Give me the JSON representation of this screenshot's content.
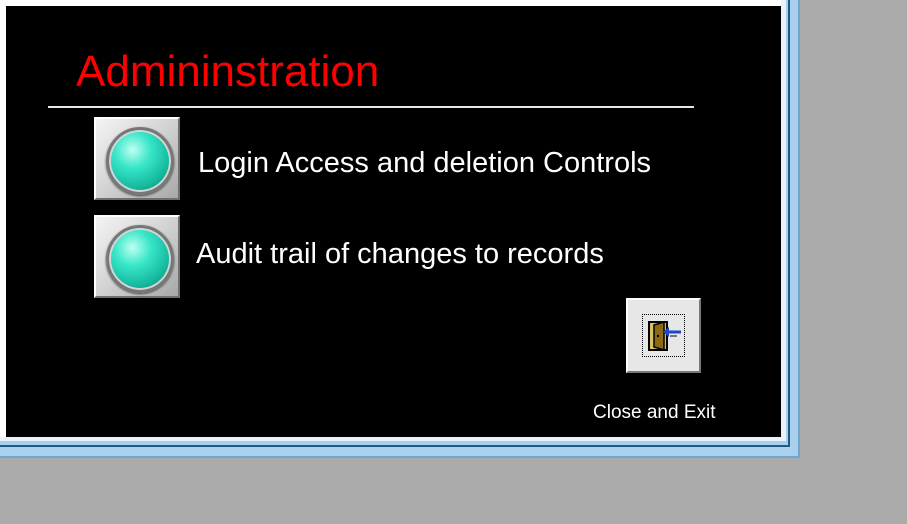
{
  "colors": {
    "panel_background": "#000000",
    "title_color": "#ff0000",
    "text_color": "#ffffff",
    "led_color": "#37e6c8",
    "desktop_background": "#ababab"
  },
  "title": "Admininstration",
  "options": [
    {
      "label": "Login Access and deletion Controls",
      "icon": "green-indicator-button"
    },
    {
      "label": "Audit trail of changes to records",
      "icon": "green-indicator-button"
    }
  ],
  "exit": {
    "label": "Close  and Exit",
    "icon": "door-exit-icon"
  }
}
